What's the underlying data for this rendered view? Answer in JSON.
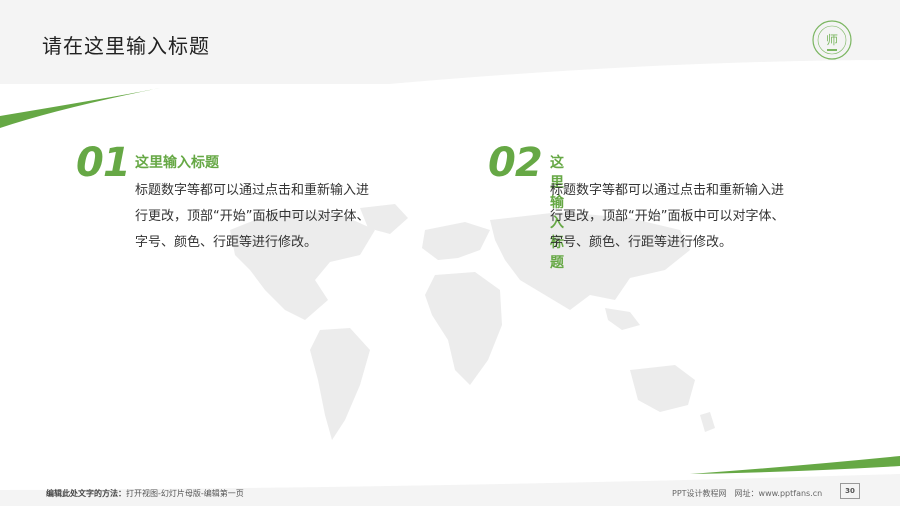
{
  "page": {
    "title": "请在这里输入标题"
  },
  "blocks": [
    {
      "number": "01",
      "heading": "这里输入标题",
      "lines": [
        "标题数字等都可以通过点击和重新输入进",
        "行更改，顶部“开始”面板中可以对字体、",
        "字号、颜色、行距等进行修改。"
      ]
    },
    {
      "number": "02",
      "heading": "这里输入标题",
      "lines": [
        "标题数字等都可以通过点击和重新输入进",
        "行更改，顶部“开始”面板中可以对字体、",
        "字号、颜色、行距等进行修改。"
      ]
    }
  ],
  "footer": {
    "hint_label": "编辑此处文字的方法：",
    "hint_text": "打开视图-幻灯片母版-编辑第一页",
    "site_text": "PPT设计教程网　网址：www.pptfans.cn",
    "page_number": "30"
  },
  "colors": {
    "accent": "#66a845",
    "header_bg": "#f4f4f4",
    "map": "#ececec"
  },
  "icons": {
    "logo": "university-seal-icon",
    "map": "world-map-icon"
  }
}
